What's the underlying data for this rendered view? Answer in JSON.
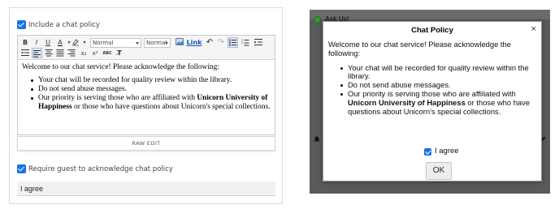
{
  "settings": {
    "include_policy_label": "Include a chat policy",
    "include_policy_checked": true,
    "require_ack_label": "Require guest to acknowledge chat policy",
    "require_ack_checked": true,
    "agree_text_value": "I agree",
    "raw_edit_label": "RAW EDIT"
  },
  "toolbar": {
    "bold": "B",
    "italic": "I",
    "underline": "U",
    "text_color": "A",
    "format_select": "Normal",
    "size_select": "Normal",
    "link": "Link",
    "subscript": "x₂",
    "superscript": "x²",
    "abc": "ABC",
    "clear_format": "T̸"
  },
  "policy": {
    "intro": "Welcome to our chat service! Please acknowledge the following:",
    "items": [
      "Your chat will be recorded for quality review within the library.",
      "Do not send abuse messages."
    ],
    "priority_prefix": "Our priority is serving those who are affiliated with ",
    "priority_bold": "Unicorn University of Happiness",
    "priority_suffix": " or those who have questions about Unicorn's special collections."
  },
  "widget": {
    "header_title": "Ask Us!",
    "modal_title": "Chat Policy",
    "close_glyph": "×",
    "agree_label": "I agree",
    "agree_checked": true,
    "ok_label": "OK"
  },
  "colors": {
    "checkbox": "#1a73e8",
    "widget_bg": "#5a5a5a",
    "status_online": "#2e9c2e"
  }
}
